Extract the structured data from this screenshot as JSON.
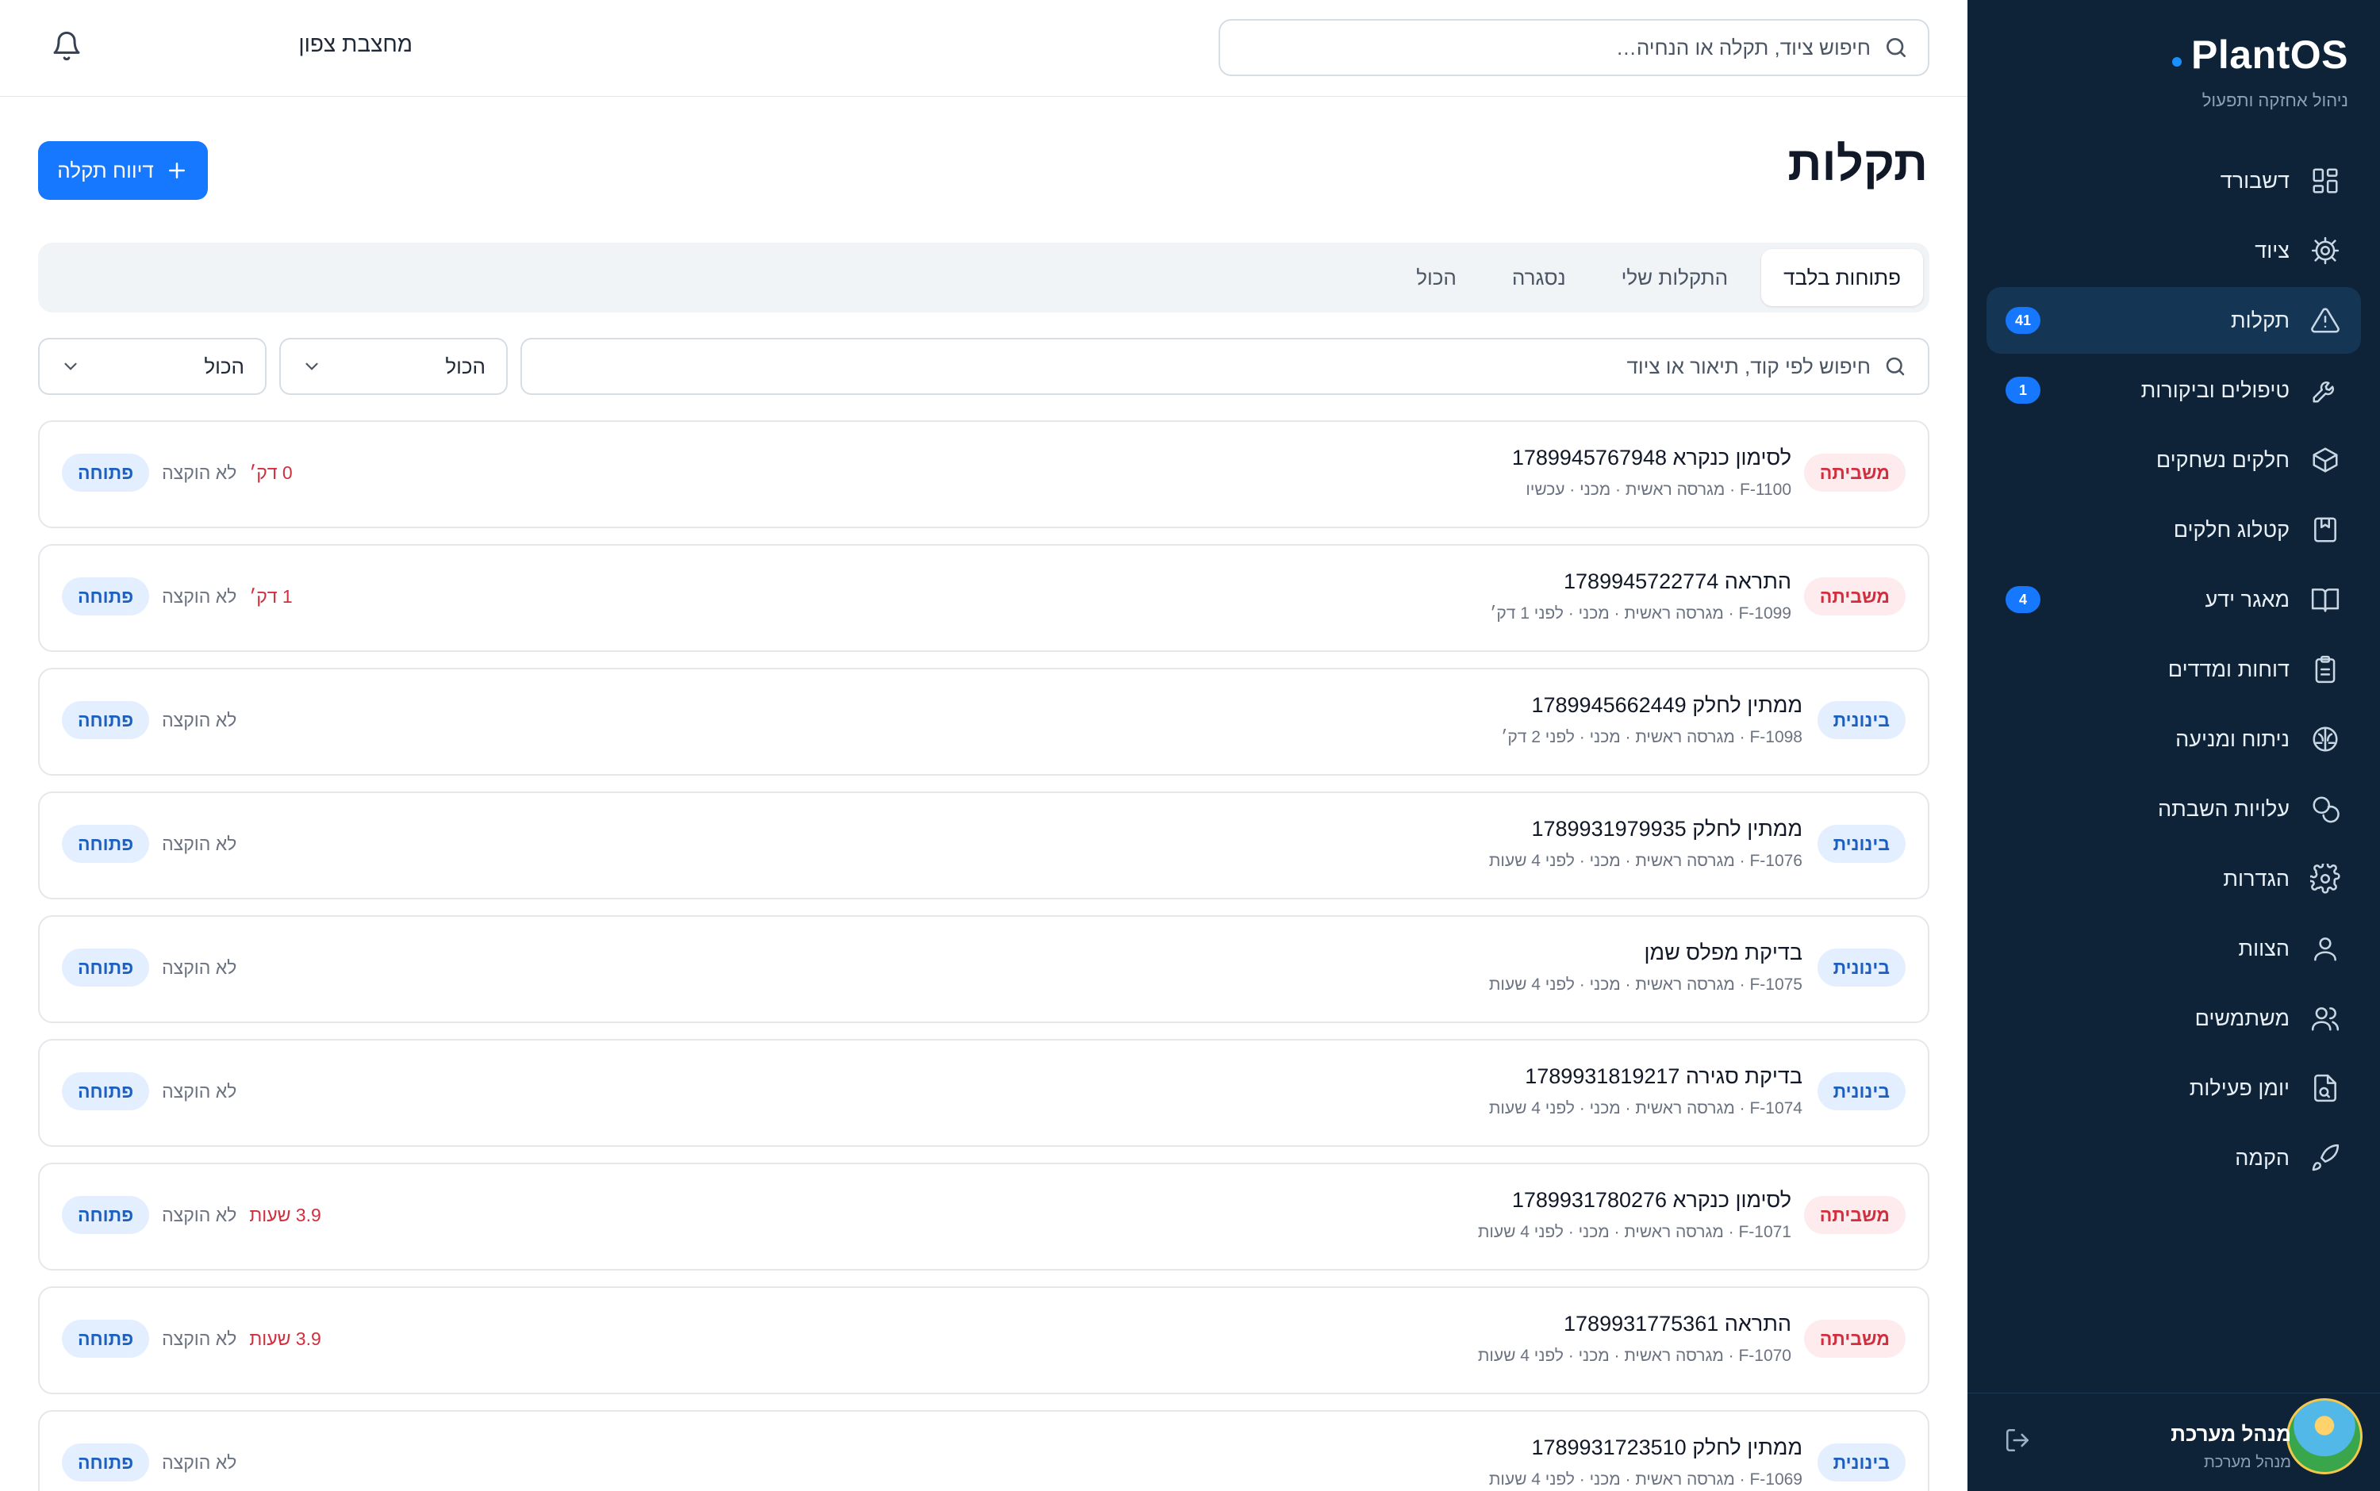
{
  "brand": {
    "title": "PlantOS",
    "subtitle": "ניהול אחזקה ותפעול"
  },
  "topbar": {
    "search_placeholder": "חיפוש ציוד, תקלה או הנחיה…",
    "site_name": "מחצבת צפון"
  },
  "sidebar": {
    "items": [
      {
        "label": "דשבורד",
        "icon": "dashboard-icon"
      },
      {
        "label": "ציוד",
        "icon": "gear-icon"
      },
      {
        "label": "תקלות",
        "icon": "warning-icon",
        "badge": "41",
        "active": true
      },
      {
        "label": "טיפולים וביקורות",
        "icon": "wrench-icon",
        "badge": "1"
      },
      {
        "label": "חלקים נשחקים",
        "icon": "box-icon"
      },
      {
        "label": "קטלוג חלקים",
        "icon": "catalog-icon"
      },
      {
        "label": "מאגר ידע",
        "icon": "book-icon",
        "badge": "4"
      },
      {
        "label": "דוחות ומדדים",
        "icon": "clipboard-icon"
      },
      {
        "label": "ניתוח ומניעה",
        "icon": "brain-icon"
      },
      {
        "label": "עלויות השבתה",
        "icon": "coins-icon"
      },
      {
        "label": "הגדרות",
        "icon": "settings-icon"
      },
      {
        "label": "הצוות",
        "icon": "user-icon"
      },
      {
        "label": "משתמשים",
        "icon": "users-icon"
      },
      {
        "label": "יומן פעילות",
        "icon": "log-icon"
      },
      {
        "label": "הקמה",
        "icon": "rocket-icon"
      }
    ]
  },
  "user": {
    "name": "מנהל מערכת",
    "role": "מנהל מערכת"
  },
  "page": {
    "title": "תקלות",
    "add_button": "דיווח תקלה"
  },
  "tabs": [
    {
      "label": "פתוחות בלבד",
      "active": true
    },
    {
      "label": "התקלות שלי"
    },
    {
      "label": "נסגרה"
    },
    {
      "label": "הכול"
    }
  ],
  "filters": {
    "search_placeholder": "חיפוש לפי קוד, תיאור או ציוד",
    "select_1": "הכול",
    "select_2": "הכול"
  },
  "colors": {
    "sidebar_bg": "#0e2338",
    "accent": "#1677ff",
    "critical": "#d12f3e",
    "medium": "#1d5fbf"
  },
  "faults": [
    {
      "severity": "משביתה",
      "severity_type": "critical",
      "title": "לסימון כנקרא 1789945767948",
      "meta": "F-1100 · מגרסה ראשית · מכני · עכשיו",
      "status": "פתוחה",
      "assignee": "לא הוקצה",
      "elapsed": "0 דק׳"
    },
    {
      "severity": "משביתה",
      "severity_type": "critical",
      "title": "התראה 1789945722774",
      "meta": "F-1099 · מגרסה ראשית · מכני · לפני 1 דק׳",
      "status": "פתוחה",
      "assignee": "לא הוקצה",
      "elapsed": "1 דק׳"
    },
    {
      "severity": "בינונית",
      "severity_type": "medium",
      "title": "ממתין לחלק 1789945662449",
      "meta": "F-1098 · מגרסה ראשית · מכני · לפני 2 דק׳",
      "status": "פתוחה",
      "assignee": "לא הוקצה",
      "elapsed": ""
    },
    {
      "severity": "בינונית",
      "severity_type": "medium",
      "title": "ממתין לחלק 1789931979935",
      "meta": "F-1076 · מגרסה ראשית · מכני · לפני 4 שעות",
      "status": "פתוחה",
      "assignee": "לא הוקצה",
      "elapsed": ""
    },
    {
      "severity": "בינונית",
      "severity_type": "medium",
      "title": "בדיקת מפלס שמן",
      "meta": "F-1075 · מגרסה ראשית · מכני · לפני 4 שעות",
      "status": "פתוחה",
      "assignee": "לא הוקצה",
      "elapsed": ""
    },
    {
      "severity": "בינונית",
      "severity_type": "medium",
      "title": "בדיקת סגירה 1789931819217",
      "meta": "F-1074 · מגרסה ראשית · מכני · לפני 4 שעות",
      "status": "פתוחה",
      "assignee": "לא הוקצה",
      "elapsed": ""
    },
    {
      "severity": "משביתה",
      "severity_type": "critical",
      "title": "לסימון כנקרא 1789931780276",
      "meta": "F-1071 · מגרסה ראשית · מכני · לפני 4 שעות",
      "status": "פתוחה",
      "assignee": "לא הוקצה",
      "elapsed": "3.9 שעות"
    },
    {
      "severity": "משביתה",
      "severity_type": "critical",
      "title": "התראה 1789931775361",
      "meta": "F-1070 · מגרסה ראשית · מכני · לפני 4 שעות",
      "status": "פתוחה",
      "assignee": "לא הוקצה",
      "elapsed": "3.9 שעות"
    },
    {
      "severity": "בינונית",
      "severity_type": "medium",
      "title": "ממתין לחלק 1789931723510",
      "meta": "F-1069 · מגרסה ראשית · מכני · לפני 4 שעות",
      "status": "פתוחה",
      "assignee": "לא הוקצה",
      "elapsed": ""
    }
  ]
}
